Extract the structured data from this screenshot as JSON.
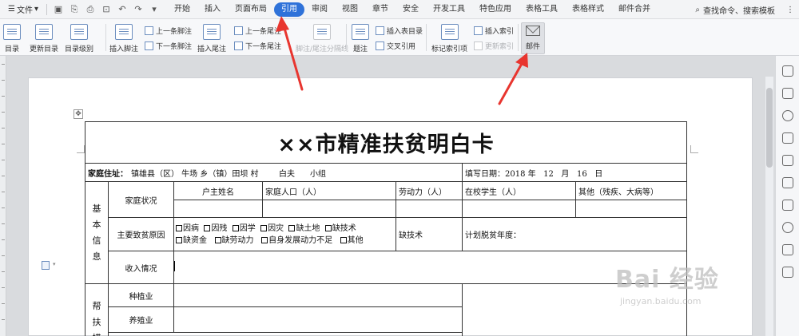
{
  "menubar": {
    "file_menu": "文件",
    "tabs": [
      "开始",
      "插入",
      "页面布局",
      "引用",
      "审阅",
      "视图",
      "章节",
      "安全",
      "开发工具",
      "特色应用",
      "表格工具",
      "表格样式",
      "邮件合并"
    ],
    "active_tab": "引用",
    "search": "查找命令、搜索模板"
  },
  "ribbon": {
    "toc": "目录",
    "update_toc": "更新目录",
    "toc_level": "目录级别",
    "insert_footnote": "插入脚注",
    "prev_footnote": "上一条脚注",
    "next_footnote": "下一条脚注",
    "insert_endnote": "插入尾注",
    "prev_endnote": "上一条尾注",
    "next_endnote": "下一条尾注",
    "note_separator": "脚注/尾注分隔线",
    "caption": "题注",
    "insert_table_of_figures": "插入表目录",
    "cross_reference": "交叉引用",
    "mark_index_entry": "标记索引项",
    "insert_index": "插入索引",
    "update_index": "更新索引",
    "mail": "邮件"
  },
  "document": {
    "title": "××市精准扶贫明白卡",
    "address_label": "家庭住址：",
    "address_value": "镇雄县（区） 牛场 乡（镇）田坝 村        白夫      小组",
    "date_label": "填写日期：",
    "date_value": "2018 年   12   月   16   日",
    "section_basic": "基本信息",
    "family_status": "家庭状况",
    "headers": [
      "户主姓名",
      "家庭人口（人）",
      "劳动力（人）",
      "在校学生（人）",
      "其他（残疾、大病等）"
    ],
    "poverty_reason_label": "主要致贫原因",
    "reasons_row1": [
      "因病",
      "因残",
      "因学",
      "因灾",
      "缺土地",
      "缺技术"
    ],
    "reasons_row2": [
      "缺资金",
      "缺劳动力",
      "自身发展动力不足",
      "其他"
    ],
    "selected_reason": "缺技术",
    "plan_label": "计划脱贫年度：",
    "income_label": "收入情况",
    "section_help": "帮扶措",
    "planting": "种植业",
    "breeding": "养殖业"
  },
  "watermark": {
    "main": "Bai 经验",
    "sub": "jingyan.baidu.com"
  }
}
